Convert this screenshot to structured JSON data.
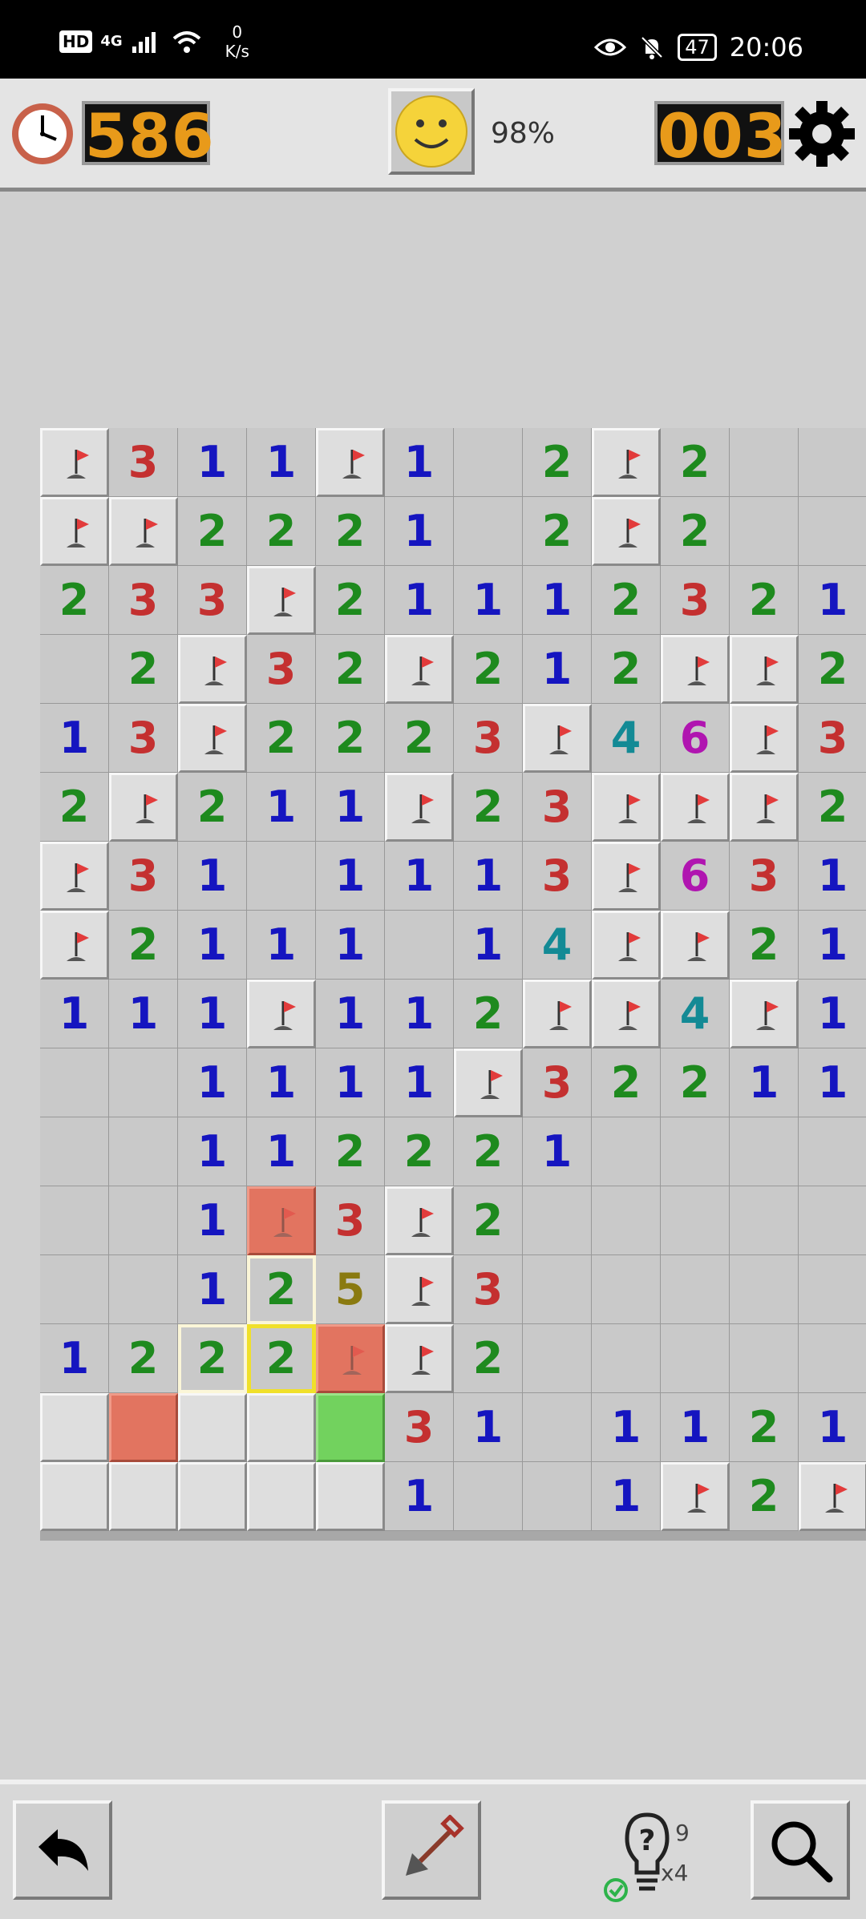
{
  "status_bar": {
    "hd": "HD",
    "network": "4G",
    "speed_value": "0",
    "speed_unit": "K/s",
    "battery": "47",
    "time": "20:06",
    "icons": [
      "hd-icon",
      "signal-icon",
      "wifi-icon",
      "eye-icon",
      "mute-icon",
      "battery-icon"
    ]
  },
  "header": {
    "timer": "586",
    "status_percent": "98%",
    "mines_left": "003",
    "icons": [
      "clock-icon",
      "smiley-icon",
      "settings-gear-icon"
    ]
  },
  "board": {
    "cols": 12,
    "visible_rows": 16,
    "legend": "F = flag, . = open empty, digit = revealed count, U = unopened, R = red highlighted flag, E = red tile, G = green tile",
    "rows": [
      [
        "F",
        "3",
        "1",
        "1",
        "F",
        "1",
        ".",
        "2",
        "F",
        "2",
        ".",
        "."
      ],
      [
        "F",
        "F",
        "2",
        "2",
        "2",
        "1",
        ".",
        "2",
        "F",
        "2",
        ".",
        "."
      ],
      [
        "2",
        "3",
        "3",
        "F",
        "2",
        "1",
        "1",
        "1",
        "2",
        "3",
        "2",
        "1"
      ],
      [
        ".",
        "2",
        "F",
        "3",
        "2",
        "F",
        "2",
        "1",
        "2",
        "F",
        "F",
        "2"
      ],
      [
        "1",
        "3",
        "F",
        "2",
        "2",
        "2",
        "3",
        "F",
        "4",
        "6",
        "F",
        "3"
      ],
      [
        "2",
        "F",
        "2",
        "1",
        "1",
        "F",
        "2",
        "3",
        "F",
        "F",
        "F",
        "2"
      ],
      [
        "F",
        "3",
        "1",
        ".",
        "1",
        "1",
        "1",
        "3",
        "F",
        "6",
        "3",
        "1"
      ],
      [
        "F",
        "2",
        "1",
        "1",
        "1",
        ".",
        "1",
        "4",
        "F",
        "F",
        "2",
        "1"
      ],
      [
        "1",
        "1",
        "1",
        "F",
        "1",
        "1",
        "2",
        "F",
        "F",
        "4",
        "F",
        "1"
      ],
      [
        ".",
        ".",
        "1",
        "1",
        "1",
        "1",
        "F",
        "3",
        "2",
        "2",
        "1",
        "1"
      ],
      [
        ".",
        ".",
        "1",
        "1",
        "2",
        "2",
        "2",
        "1",
        ".",
        ".",
        ".",
        "."
      ],
      [
        ".",
        ".",
        "1",
        "R",
        "3",
        "F",
        "2",
        ".",
        ".",
        ".",
        ".",
        "."
      ],
      [
        ".",
        ".",
        "1",
        "2",
        "5",
        "F",
        "3",
        ".",
        ".",
        ".",
        ".",
        "."
      ],
      [
        "1",
        "2",
        "2",
        "2",
        "R",
        "F",
        "2",
        ".",
        ".",
        ".",
        ".",
        "."
      ],
      [
        "U",
        "E",
        "U",
        "U",
        "G",
        "3",
        "1",
        ".",
        "1",
        "1",
        "2",
        "1"
      ],
      [
        "U",
        "U",
        "U",
        "U",
        "U",
        "1",
        ".",
        ".",
        "1",
        "F",
        "2",
        "F"
      ]
    ],
    "highlights": [
      {
        "row": 12,
        "col": 3,
        "style": "soft"
      },
      {
        "row": 13,
        "col": 2,
        "style": "soft"
      },
      {
        "row": 13,
        "col": 3,
        "style": "yellow"
      }
    ],
    "number_colors": {
      "1": "#1515c0",
      "2": "#1e8a1e",
      "3": "#c43030",
      "4": "#138a95",
      "5": "#8a7a10",
      "6": "#b015b0"
    }
  },
  "toolbar": {
    "hint_count": "9",
    "hint_solved": "x4",
    "icons": [
      "undo-icon",
      "shovel-icon",
      "hint-bulb-icon",
      "magnifier-icon"
    ]
  }
}
